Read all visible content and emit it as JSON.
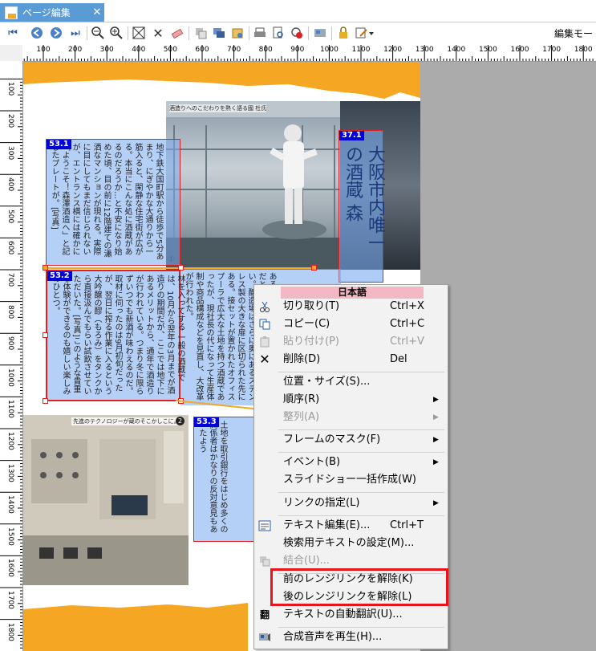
{
  "tab": {
    "title": "ページ編集",
    "close": "✕"
  },
  "toolbar": {
    "mode_label": "編集モー"
  },
  "ruler": {
    "h": [
      "100",
      "200",
      "300",
      "400",
      "500",
      "600",
      "700",
      "800",
      "900",
      "1000",
      "1100",
      "1200",
      "1300",
      "1400",
      "1500",
      "1600",
      "1700",
      "1800"
    ],
    "v": [
      "100",
      "200",
      "300",
      "400",
      "500",
      "600",
      "700",
      "800",
      "900",
      "1000",
      "1100",
      "1200",
      "1300",
      "1400",
      "1500",
      "1600",
      "1700",
      "1800"
    ]
  },
  "page": {
    "photo1_caption": "酒造りへのこだわりを熱く語る國 杜氏",
    "photo2_caption": "先進のテクノロジーが蔵のそこかしこに。",
    "photo2_num": "2",
    "marker1": "①",
    "frames": [
      {
        "id": "53.1",
        "text": "地下鉄大国町駅から徒歩で5分あまり、にぎやかな大通りから一筋入ると、閑静な住宅街が広がる。本当にこんな処に酒蔵があるのだろうか…と不安になり始めた頃、目の前に12階建ての瀟洒なマンションが現れる。実際に目にしてもまだ信じられないが、エントランス横には確かに「ようこそ！森澤酒造へ」と記したプレートが。[写真]"
      },
      {
        "id": "53.2",
        "text": "林を入ってする 一般の酒蔵では、10月から翌年の3月までが酒造りの期間だが、ここでは地下にあるメリットから、通年で酒造りが行われている。つまり冬に限らずいつでも新酒が味わえるのだ。取材に伺ったのは9月初旬だったが、翌日に搾る作業に入るという大吟醸の醪（もろみ）をタンクから直接汲んでもらい試飲させていただいた。[写真]このような貴重な体験ができるのも嬉しい楽しみのひとつ。"
      },
      {
        "id": "53.3",
        "text": "土地を取引銀行をはじめ多くの関係者はかなりの反対意見もあったよう"
      },
      {
        "id": "37.1",
        "text": "大阪市内唯一の酒蔵 森"
      }
    ],
    "col2_text": "ある。天井が高く明るいので、地下だというのに息苦しさは感じさせない。醸造場はさらに奥にあるステンレス製の大きな扉に区切られた先にある。接セットが置かれたオフィスプーラで広大な土地を持つ酒蔵であったが、現社長の代になって生産体制や商品構成などを見直し、大改革が行われた。"
  },
  "menu": {
    "header": "日本語",
    "items": {
      "cut": {
        "label": "切り取り(T)",
        "key": "Ctrl+X"
      },
      "copy": {
        "label": "コピー(C)",
        "key": "Ctrl+C"
      },
      "paste": {
        "label": "貼り付け(P)",
        "key": "Ctrl+V"
      },
      "delete": {
        "label": "削除(D)",
        "key": "Del"
      },
      "position": {
        "label": "位置・サイズ(S)..."
      },
      "order": {
        "label": "順序(R)"
      },
      "align": {
        "label": "整列(A)"
      },
      "mask": {
        "label": "フレームのマスク(F)"
      },
      "event": {
        "label": "イベント(B)"
      },
      "slideshow": {
        "label": "スライドショー一括作成(W)"
      },
      "link": {
        "label": "リンクの指定(L)"
      },
      "textedit": {
        "label": "テキスト編集(E)...",
        "key": "Ctrl+T"
      },
      "searchtext": {
        "label": "検索用テキストの設定(M)..."
      },
      "merge": {
        "label": "結合(U)..."
      },
      "unlinkprev": {
        "label": "前のレンジリンクを解除(K)"
      },
      "unlinknext": {
        "label": "後のレンジリンクを解除(L)"
      },
      "translate": {
        "label": "テキストの自動翻訳(U)..."
      },
      "speech": {
        "label": "合成音声を再生(H)..."
      }
    }
  },
  "colors": {
    "accent": "#5b9bd5",
    "highlight": "#e8141c",
    "frame_border": "#e02020",
    "page_band": "#f5a623"
  }
}
